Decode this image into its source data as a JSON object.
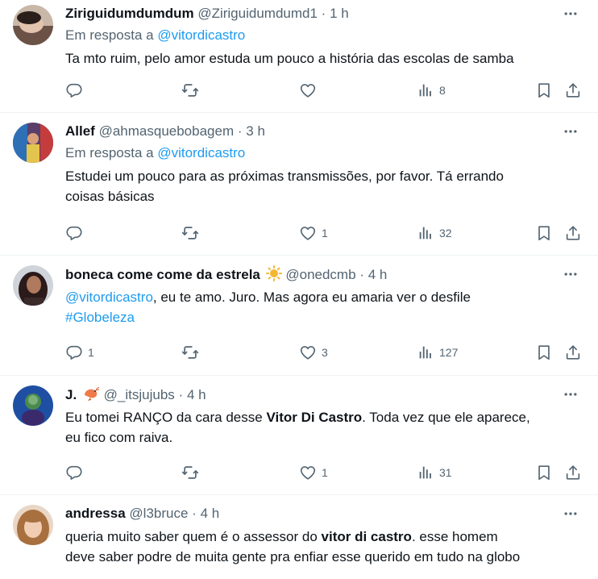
{
  "colors": {
    "link": "#1d9bf0",
    "muted": "#536471",
    "text": "#0f1419",
    "divider": "#eff3f4"
  },
  "icons": [
    "more-icon",
    "reply-icon",
    "retweet-icon",
    "like-icon",
    "views-icon",
    "bookmark-icon",
    "share-icon",
    "sun-emoji",
    "shrimp-emoji"
  ],
  "tweets": [
    {
      "name": "Ziriguidumdumdum",
      "handle": "@Ziriguidumdumd1",
      "dot": "·",
      "time": "1 h",
      "reply_prefix": "Em resposta a",
      "reply_to": "@vitordicastro",
      "text": "Ta mto ruim, pelo amor estuda um pouco a história das escolas de samba",
      "replies": "",
      "retweets": "",
      "likes": "",
      "views": "8"
    },
    {
      "name": "Allef",
      "handle": "@ahmasquebobagem",
      "dot": "·",
      "time": "3 h",
      "reply_prefix": "Em resposta a",
      "reply_to": "@vitordicastro",
      "text_line1": "Estudei um pouco para as próximas transmissões, por favor. Tá errando",
      "text_line2": "coisas básicas",
      "replies": "",
      "retweets": "",
      "likes": "1",
      "views": "32"
    },
    {
      "name": "boneca come come da estrela",
      "handle": "@onedcmb",
      "dot": "·",
      "time": "4 h",
      "mention": "@vitordicastro",
      "text_after_mention": ", eu te amo. Juro. Mas agora eu amaria ver o desfile",
      "hashtag": "#Globeleza",
      "replies": "1",
      "retweets": "",
      "likes": "3",
      "views": "127"
    },
    {
      "name": "J.",
      "handle": "@_itsjujubs",
      "dot": "·",
      "time": "4 h",
      "text_before_bold": "Eu tomei RANÇO da cara desse ",
      "bold": "Vitor Di Castro",
      "text_after_bold": ". Toda vez que ele aparece,",
      "text_line2": "eu fico com raiva.",
      "replies": "",
      "retweets": "",
      "likes": "1",
      "views": "31"
    },
    {
      "name": "andressa",
      "handle": "@l3bruce",
      "dot": "·",
      "time": "4 h",
      "text_before_bold": "queria muito saber quem é o assessor do ",
      "bold": "vitor di castro",
      "text_after_bold": ". esse homem",
      "text_line2": "deve saber podre de muita gente pra enfiar esse querido em tudo na globo"
    }
  ]
}
